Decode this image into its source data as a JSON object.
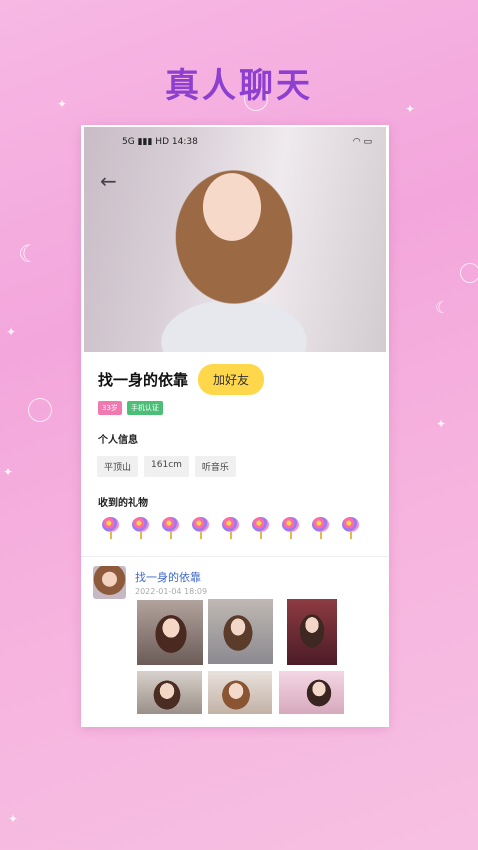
{
  "headline": "真人聊天",
  "phone_status": {
    "time": "14:38",
    "signal": "5G",
    "hd": "HD"
  },
  "profile": {
    "nickname": "找一身的依靠",
    "add_friend_label": "加好友",
    "badges": [
      "33岁",
      "手机认证"
    ],
    "info_title": "个人信息",
    "tags": [
      "平顶山",
      "161cm",
      "听音乐"
    ],
    "gifts_title": "收到的礼物",
    "gift_count": 9,
    "gift_icon": "lollipop-icon"
  },
  "post": {
    "author": "找一身的依靠",
    "time": "2022-01-04 18:09",
    "photo_count": 6
  },
  "colors": {
    "headline": "#8d3fd0",
    "add_friend_bg": "#ffd74a",
    "author_name": "#3f68c9",
    "age_badge": "#f07ab0",
    "verify_badge": "#4cbf77"
  }
}
